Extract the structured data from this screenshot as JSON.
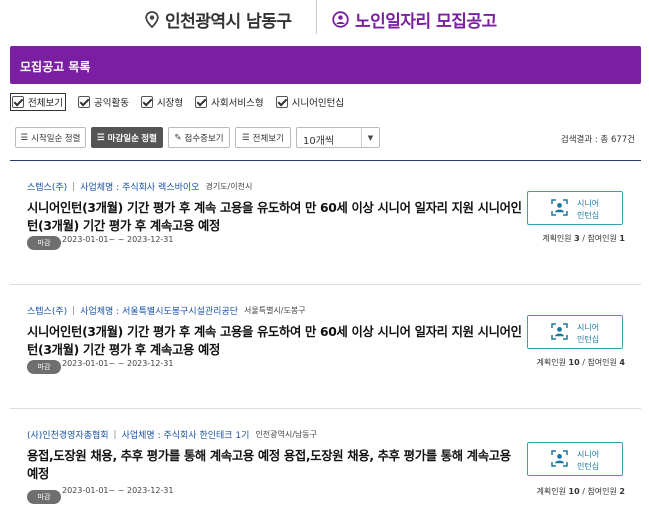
{
  "header": {
    "region": "인천광역시 남동구",
    "service": "노인일자리 모집공고",
    "accent": "#7b1fa2"
  },
  "list_title": "모집공고 목록",
  "filters": [
    {
      "label": "전체보기",
      "checked": true
    },
    {
      "label": "공익활동",
      "checked": true
    },
    {
      "label": "시장형",
      "checked": true
    },
    {
      "label": "사회서비스형",
      "checked": true
    },
    {
      "label": "시니어인턴십",
      "checked": true
    }
  ],
  "sort": {
    "start_order": "시작일순 정렬",
    "deadline_order": "마감일순 정렬",
    "accepting": "접수중보기",
    "view_all": "전체보기",
    "page_size": "10개씩",
    "result": "검색결과 : 총 677건"
  },
  "posts": [
    {
      "org": "스텝스(주)",
      "biz_prefix": "사업체명 : ",
      "biz": "주식회사 렉스바이오",
      "location": "경기도/이천시",
      "title": "시니어인턴(3개월) 기간 평가 후 계속 고용을 유도하여 만 60세 이상 시니어 일자리 지원 시니어인턴(3개월) 기간 평가 후 계속고용 예정",
      "status": "마감",
      "period": "2023-01-01~ ~ 2023-12-31",
      "type_line1": "시니어",
      "type_line2": "인턴십",
      "plan_label": "계획인원 ",
      "plan_count": "3",
      "join_label": " / 참여인원 ",
      "join_count": "1"
    },
    {
      "org": "스텝스(주)",
      "biz_prefix": "사업체명 : ",
      "biz": "서울특별시도봉구시설관리공단",
      "location": "서울특별시/도봉구",
      "title": "시니어인턴(3개월) 기간 평가 후 계속 고용을 유도하여 만 60세 이상 시니어 일자리 지원 시니어인턴(3개월) 기간 평가 후 계속고용 예정",
      "status": "마감",
      "period": "2023-01-01~ ~ 2023-12-31",
      "type_line1": "시니어",
      "type_line2": "인턴십",
      "plan_label": "계획인원 ",
      "plan_count": "10",
      "join_label": " / 참여인원 ",
      "join_count": "4"
    },
    {
      "org": "(사)인천경영자총협회",
      "biz_prefix": "사업체명 : ",
      "biz": "주식회사 한인테크 1기",
      "location": "인천광역시/남동구",
      "title": "용접,도장원 채용, 추후 평가를 통해 계속고용 예정 용접,도장원 채용, 추후 평가를 통해 계속고용 예정",
      "status": "마감",
      "period": "2023-01-01~ ~ 2023-12-31",
      "type_line1": "시니어",
      "type_line2": "인턴십",
      "plan_label": "계획인원 ",
      "plan_count": "10",
      "join_label": " / 참여인원 ",
      "join_count": "2"
    }
  ]
}
